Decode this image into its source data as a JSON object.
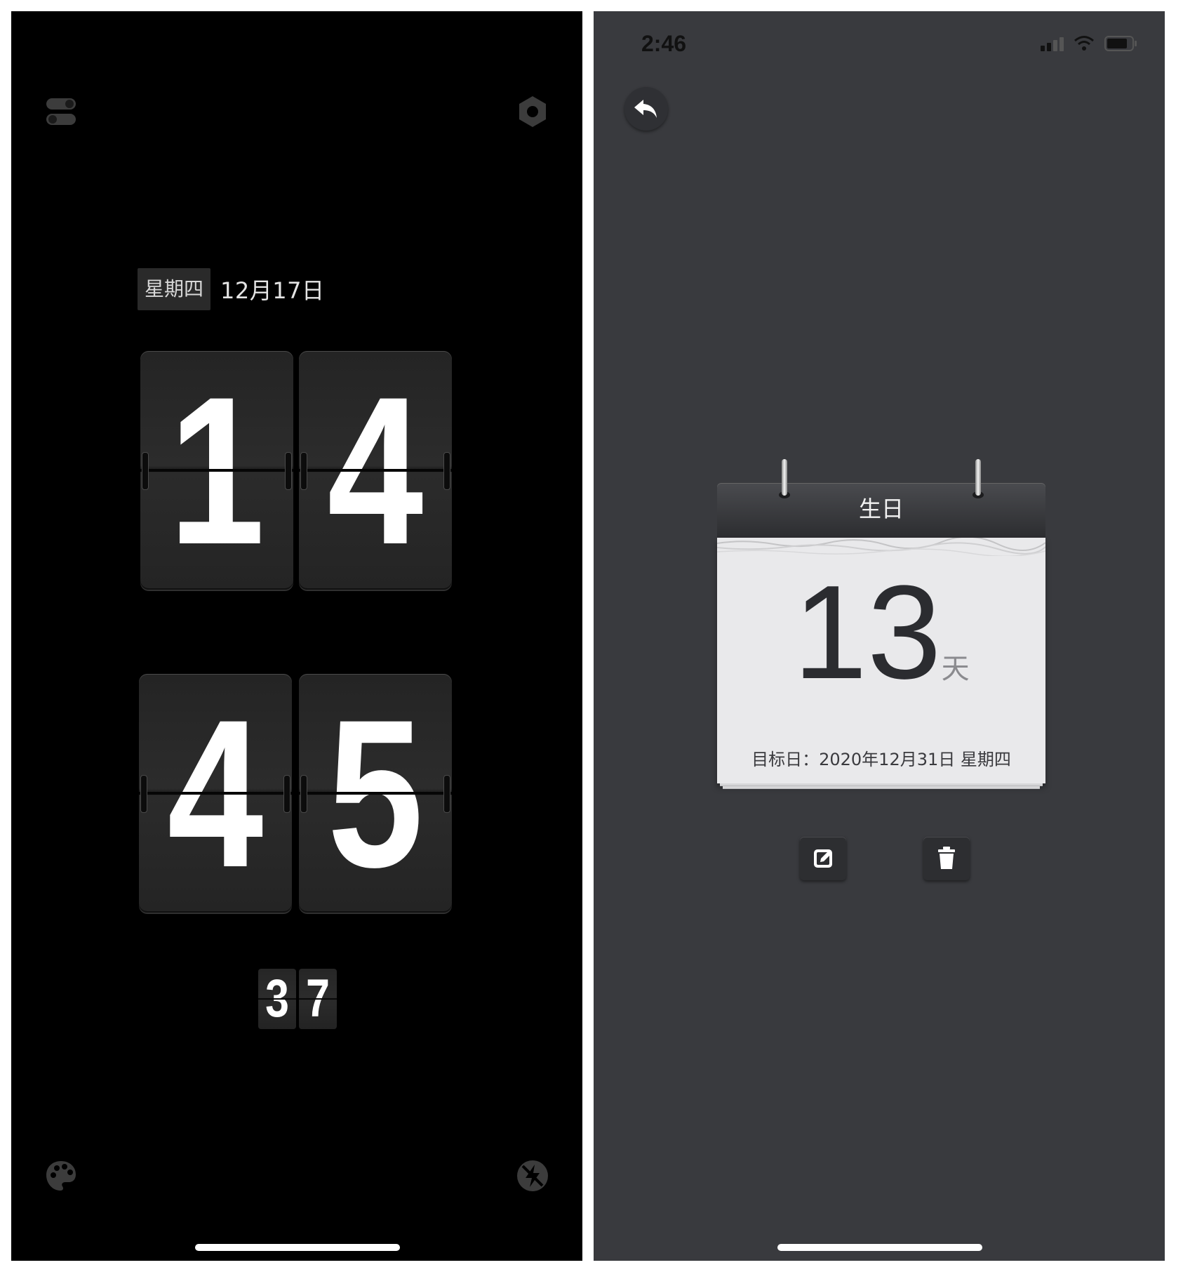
{
  "clock": {
    "weekday": "星期四",
    "date": "12月17日",
    "hour_tens": "1",
    "hour_ones": "4",
    "minute_tens": "4",
    "minute_ones": "5",
    "second_tens": "3",
    "second_ones": "7",
    "icons": {
      "top_left": "toggle-icon",
      "top_right": "settings-icon",
      "bottom_left": "palette-icon",
      "bottom_right": "flash-off-icon"
    }
  },
  "countdown": {
    "status_time": "2:46",
    "back_icon": "undo-arrow-icon",
    "title": "生日",
    "days": "13",
    "unit": "天",
    "target_label": "目标日：",
    "target_date": "2020年12月31日 星期四",
    "actions": {
      "edit_icon": "edit-icon",
      "delete_icon": "trash-icon"
    }
  },
  "colors": {
    "clock_background": "#000000",
    "countdown_background": "#393a3e",
    "calendar_page": "#e9e9eb"
  }
}
